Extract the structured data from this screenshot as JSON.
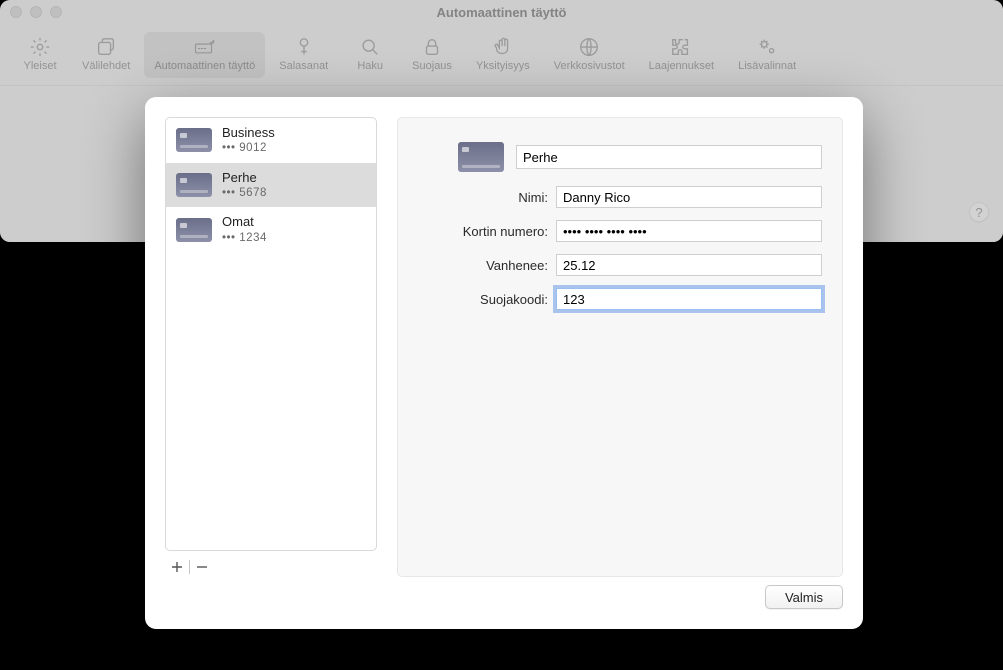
{
  "window": {
    "title": "Automaattinen täyttö"
  },
  "toolbar": {
    "general": "Yleiset",
    "tabs": "Välilehdet",
    "autofill": "Automaattinen täyttö",
    "passwords": "Salasanat",
    "search": "Haku",
    "security": "Suojaus",
    "privacy": "Yksityisyys",
    "websites": "Verkkosivustot",
    "extensions": "Laajennukset",
    "advanced": "Lisävalinnat"
  },
  "help": "?",
  "cards": [
    {
      "name": "Business",
      "last4": "••• 9012"
    },
    {
      "name": "Perhe",
      "last4": "••• 5678"
    },
    {
      "name": "Omat",
      "last4": "••• 1234"
    }
  ],
  "form": {
    "description": "Perhe",
    "label_name": "Nimi:",
    "label_number": "Kortin numero:",
    "label_expiry": "Vanhenee:",
    "label_cvv": "Suojakoodi:",
    "name": "Danny Rico",
    "number": "•••• •••• •••• ••••",
    "expiry": "25.12",
    "cvv": "123"
  },
  "buttons": {
    "done": "Valmis"
  }
}
